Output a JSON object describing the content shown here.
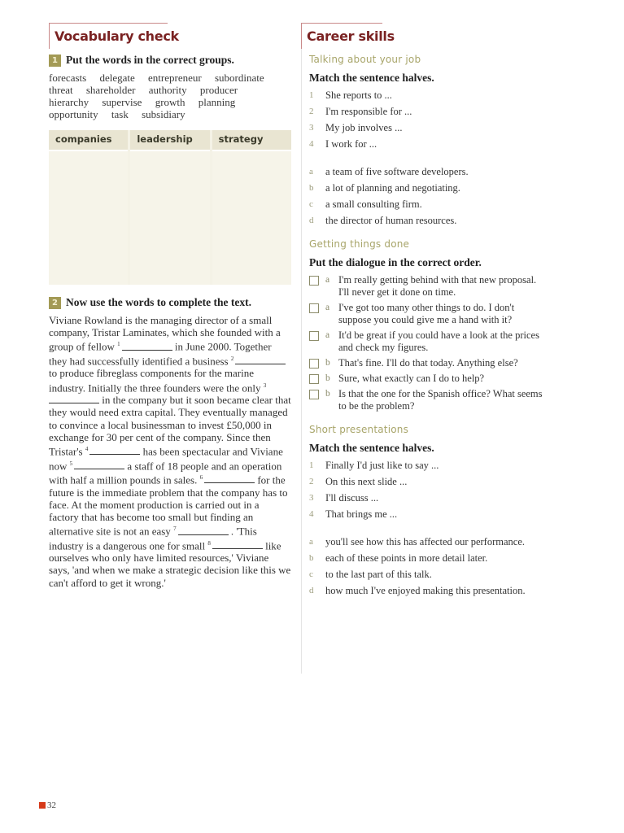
{
  "vocab": {
    "title": "Vocabulary check",
    "ex1": {
      "number": "1",
      "instruction": "Put the words in the correct groups.",
      "word_lines": [
        [
          "forecasts",
          "delegate",
          "entrepreneur",
          "subordinate"
        ],
        [
          "threat",
          "shareholder",
          "authority",
          "producer"
        ],
        [
          "hierarchy",
          "supervise",
          "growth",
          "planning"
        ],
        [
          "opportunity",
          "task",
          "subsidiary"
        ]
      ],
      "groups": [
        "companies",
        "leadership",
        "strategy"
      ]
    },
    "ex2": {
      "number": "2",
      "instruction": "Now use the words to complete the text.",
      "segments": [
        "Viviane Rowland is the managing director of a small company, Tristar Laminates, which she founded with a group of fellow ",
        " in June 2000. Together they had successfully identified a business ",
        " to produce fibreglass components for the marine industry. Initially the three founders were the only ",
        " in the company but it soon became clear that they would need extra capital. They eventually managed to convince a local businessman to invest £50,000 in exchange for 30 per cent of the company. Since then Tristar's ",
        " has been spectacular and Viviane now ",
        " a staff of 18 people and an operation with half a million pounds in sales. ",
        " for the future is the immediate problem that the company has to face. At the moment production is carried out in a factory that has become too small but finding an alternative site is not an easy ",
        " . 'This industry is a dangerous one for small ",
        " like ourselves who only have limited resources,' Viviane says, 'and when we make a strategic decision like this we can't afford to get it wrong.'"
      ],
      "blank_numbers": [
        "1",
        "2",
        "3",
        "4",
        "5",
        "6",
        "7",
        "8"
      ]
    }
  },
  "career": {
    "title": "Career skills",
    "talking": {
      "subtitle": "Talking about your job",
      "instruction": "Match the sentence halves.",
      "starts": [
        {
          "key": "1",
          "text": "She reports to ..."
        },
        {
          "key": "2",
          "text": "I'm responsible for ..."
        },
        {
          "key": "3",
          "text": "My job involves ..."
        },
        {
          "key": "4",
          "text": "I work for ..."
        }
      ],
      "ends": [
        {
          "key": "a",
          "text": "a team of five software developers."
        },
        {
          "key": "b",
          "text": "a lot of planning and negotiating."
        },
        {
          "key": "c",
          "text": "a small consulting firm."
        },
        {
          "key": "d",
          "text": "the director of human resources."
        }
      ]
    },
    "getting": {
      "subtitle": "Getting things done",
      "instruction": "Put the dialogue in the correct order.",
      "lines": [
        {
          "key": "a",
          "text": "I'm really getting behind with that new proposal. I'll never get it done on time."
        },
        {
          "key": "a",
          "text": "I've got too many other things to do. I don't suppose you could give me a hand with it?"
        },
        {
          "key": "a",
          "text": "It'd be great if you could have a look at the prices and check my figures."
        },
        {
          "key": "b",
          "text": "That's fine. I'll do that today. Anything else?"
        },
        {
          "key": "b",
          "text": "Sure, what exactly can I do to help?"
        },
        {
          "key": "b",
          "text": "Is that the one for the Spanish office? What seems to be the problem?"
        }
      ]
    },
    "presentations": {
      "subtitle": "Short presentations",
      "instruction": "Match the sentence halves.",
      "starts": [
        {
          "key": "1",
          "text": "Finally I'd just like to say ..."
        },
        {
          "key": "2",
          "text": "On this next slide ..."
        },
        {
          "key": "3",
          "text": "I'll discuss ..."
        },
        {
          "key": "4",
          "text": "That brings me ..."
        }
      ],
      "ends": [
        {
          "key": "a",
          "text": "you'll see how this has affected our performance."
        },
        {
          "key": "b",
          "text": "each of these points in more detail later."
        },
        {
          "key": "c",
          "text": "to the last part of this talk."
        },
        {
          "key": "d",
          "text": "how much I've enjoyed making this presentation."
        }
      ]
    }
  },
  "footer": {
    "page_number": "32",
    "accent_color": "#d63a1a"
  }
}
